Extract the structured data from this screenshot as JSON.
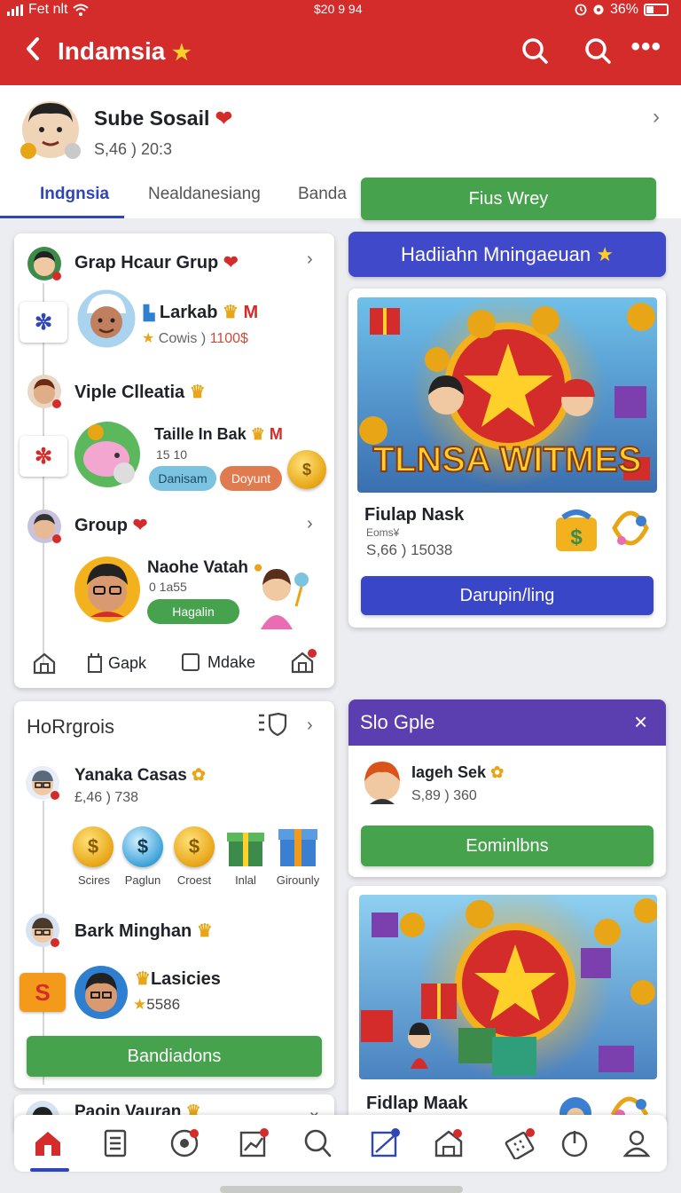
{
  "status_bar": {
    "carrier": "Fet nlt",
    "center": "$20 9 94",
    "battery": "36%"
  },
  "header": {
    "back_icon": "chevron-left-icon",
    "title": "Indamsia"
  },
  "profile": {
    "name": "Sube Sosail",
    "sub": "S,46 ) 20:3"
  },
  "tabs": [
    {
      "label": "Indgnsia"
    },
    {
      "label": "Nealdanesiang"
    },
    {
      "label": "Banda"
    }
  ],
  "tab_button": "Fius Wrey",
  "group_card": {
    "section1_title": "Grap Hcaur Grup",
    "item1": {
      "name": "Larkab",
      "badge": "M",
      "sub_a": "Cowis",
      "sub_b": "1100$"
    },
    "section2_title": "Viple Clleatia",
    "item2": {
      "name": "Taille In Bak",
      "badge": "M",
      "sub": "15 10",
      "pill1": "Danisam",
      "pill2": "Doyunt"
    },
    "section3_title": "Group",
    "item3": {
      "name": "Naohe Vatah",
      "sub": "0 1a55",
      "pill": "Hagalin"
    },
    "footer": {
      "item1": "Gapk",
      "item2": "Mdake"
    }
  },
  "banner_button": "Hadiiahn Mningaeuan",
  "promo_card": {
    "image_text": "TLNSA WITMES",
    "title": "Fiulap Nask",
    "tag": "Eoms¥",
    "sub": "S,66 ) 15038",
    "button": "Darupin/ling"
  },
  "progress_card": {
    "title": "HoRrgrois",
    "item1": {
      "name": "Yanaka Casas",
      "sub": "£,46 ) 738"
    },
    "rewards": [
      {
        "label": "Scires"
      },
      {
        "label": "Paglun"
      },
      {
        "label": "Croest"
      },
      {
        "label": "Inlal"
      },
      {
        "label": "Girounly"
      }
    ],
    "item2": {
      "name": "Bark Minghan",
      "reward_name": "Lasicies",
      "reward_value": "5586"
    },
    "button": "Bandiadons",
    "next_item": "Paoin Vauran"
  },
  "slo_card": {
    "title": "Slo Gple",
    "name": "Iageh Sek",
    "sub": "S,89 ) 360",
    "button": "Eominlbns"
  },
  "promo_card2": {
    "title": "Fidlap Maak"
  },
  "bottom_nav": [
    {
      "icon": "home-icon"
    },
    {
      "icon": "list-icon"
    },
    {
      "icon": "game-icon"
    },
    {
      "icon": "chart-icon"
    },
    {
      "icon": "search-icon"
    },
    {
      "icon": "image-icon"
    },
    {
      "icon": "store-icon"
    },
    {
      "icon": "calculator-icon"
    },
    {
      "icon": "power-icon"
    },
    {
      "icon": "user-icon"
    }
  ],
  "colors": {
    "primary_red": "#d42b2b",
    "accent_blue": "#3a46c8",
    "accent_green": "#46a24c",
    "purple": "#5b3eb0"
  }
}
